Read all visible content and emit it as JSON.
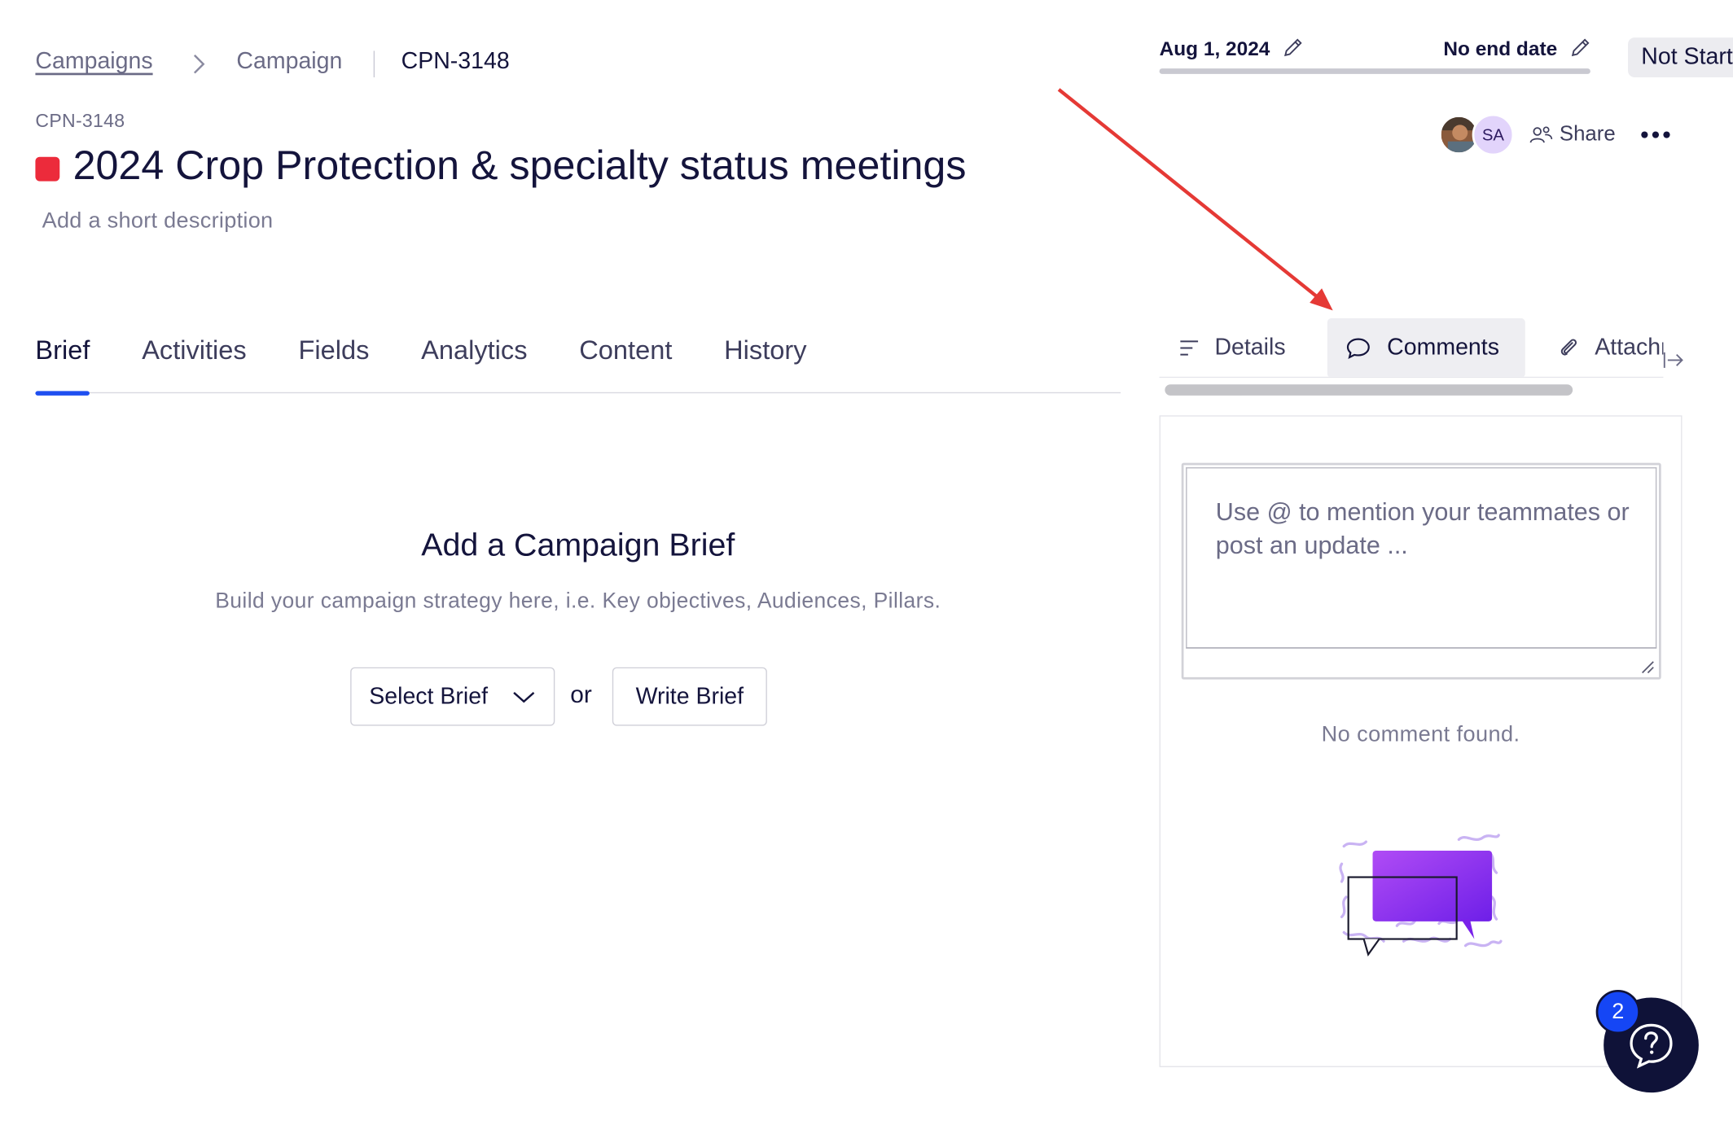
{
  "breadcrumb": {
    "root": "Campaigns",
    "middle": "Campaign",
    "current": "CPN-3148"
  },
  "campaign": {
    "id_label": "CPN-3148",
    "title": "2024 Crop Protection & specialty status meetings",
    "description_placeholder": "Add a short description",
    "color": "#ec2b3b"
  },
  "tabs": [
    {
      "label": "Brief",
      "active": true
    },
    {
      "label": "Activities",
      "active": false
    },
    {
      "label": "Fields",
      "active": false
    },
    {
      "label": "Analytics",
      "active": false
    },
    {
      "label": "Content",
      "active": false
    },
    {
      "label": "History",
      "active": false
    }
  ],
  "brief_empty": {
    "title": "Add a Campaign Brief",
    "subtitle": "Build your campaign strategy here, i.e. Key objectives, Audiences, Pillars.",
    "select_label": "Select Brief",
    "or_label": "or",
    "write_label": "Write Brief"
  },
  "dates": {
    "start": "Aug 1, 2024",
    "end": "No end date"
  },
  "status": "Not Started",
  "collaborators": {
    "initials": "SA"
  },
  "share_label": "Share",
  "side_tabs": [
    {
      "label": "Details",
      "icon": "list-icon",
      "active": false
    },
    {
      "label": "Comments",
      "icon": "chat-bubble-icon",
      "active": true
    },
    {
      "label": "Attachments",
      "icon": "paperclip-icon",
      "active": false
    }
  ],
  "comments": {
    "placeholder": "Use @ to mention your teammates or post an update ...",
    "empty_text": "No comment found."
  },
  "help": {
    "badge_count": "2"
  },
  "colors": {
    "accent": "#1f4ff0",
    "help_bg": "#0f1238",
    "badge": "#1546f5",
    "annotation": "#e53935",
    "illustration": "#8b2ff0"
  }
}
